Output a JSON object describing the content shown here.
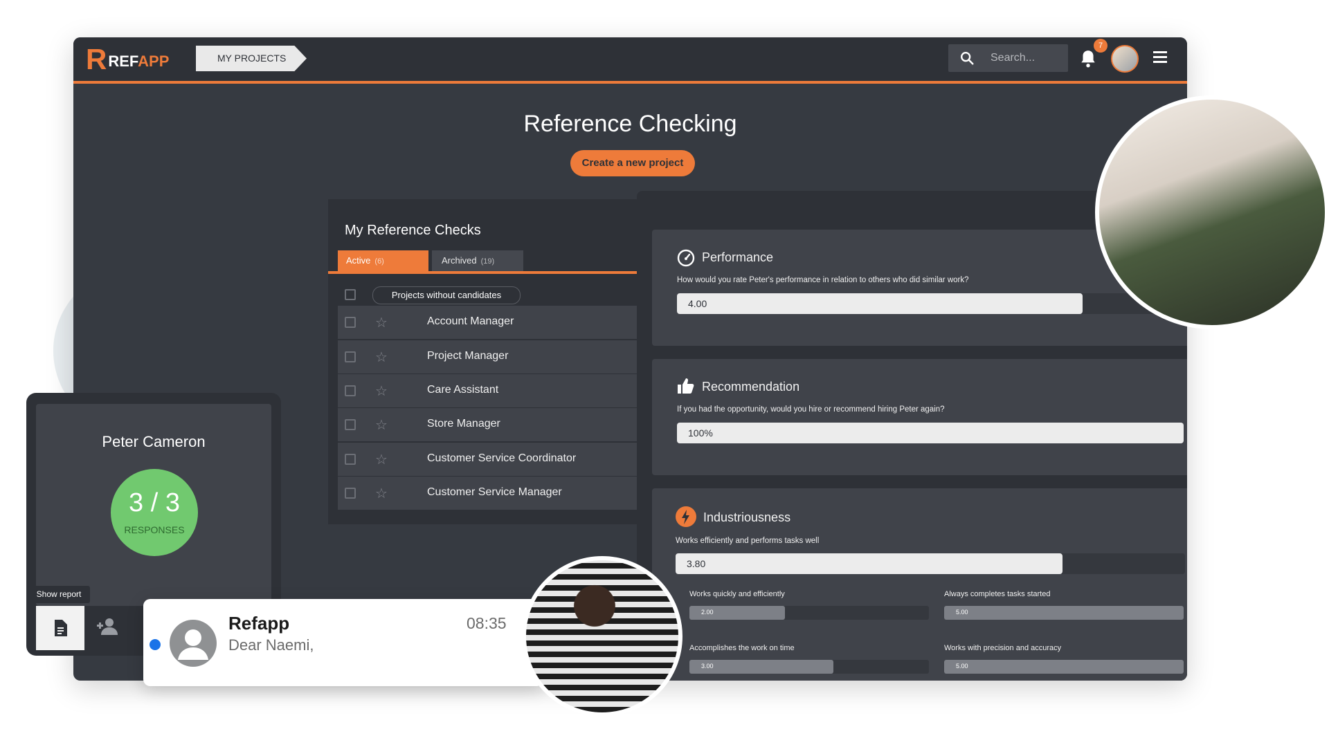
{
  "header": {
    "logo_r": "R",
    "logo_ref": "REF",
    "logo_app": "APP",
    "breadcrumb": "MY PROJECTS",
    "search_placeholder": "Search...",
    "notification_count": "7"
  },
  "page": {
    "title": "Reference Checking",
    "create_button": "Create a new project"
  },
  "reference_checks": {
    "title": "My Reference Checks",
    "tabs": [
      {
        "label": "Active",
        "count": "(6)"
      },
      {
        "label": "Archived",
        "count": "(19)"
      }
    ],
    "filter_chip": "Projects without candidates",
    "projects": [
      "Account Manager",
      "Project Manager",
      "Care Assistant",
      "Store Manager",
      "Customer Service Coordinator",
      "Customer Service Manager"
    ]
  },
  "results": {
    "performance": {
      "title": "Performance",
      "question": "How would you rate Peter's performance in relation to others who did similar work?",
      "value": "4.00",
      "fill_percent": 80
    },
    "recommendation": {
      "title": "Recommendation",
      "question": "If you had the opportunity, would you hire or recommend hiring Peter again?",
      "value": "100%",
      "fill_percent": 100
    },
    "industriousness": {
      "title": "Industriousness",
      "question": "Works efficiently and performs tasks well",
      "value": "3.80",
      "fill_percent": 76,
      "subscores": [
        {
          "label": "Works quickly and efficiently",
          "value": "2.00",
          "fill_percent": 40
        },
        {
          "label": "Always completes tasks started",
          "value": "5.00",
          "fill_percent": 100
        },
        {
          "label": "Accomplishes the work on time",
          "value": "3.00",
          "fill_percent": 60
        },
        {
          "label": "Works with precision and accuracy",
          "value": "5.00",
          "fill_percent": 100
        }
      ]
    }
  },
  "candidate": {
    "name": "Peter Cameron",
    "responses": "3 / 3",
    "responses_label": "RESPONSES",
    "show_report_tooltip": "Show report"
  },
  "notification": {
    "app": "Refapp",
    "time": "08:35",
    "message": "Dear Naemi,"
  },
  "colors": {
    "accent": "#ee7b3a",
    "background": "#363a41",
    "responses_circle": "#71c96f",
    "unread_dot": "#1a73e8"
  },
  "icons": [
    "search-icon",
    "bell-icon",
    "menu-icon",
    "star-icon",
    "performance-gauge-icon",
    "thumbs-up-icon",
    "lightning-icon",
    "document-icon",
    "people-icon",
    "user-placeholder-icon"
  ]
}
